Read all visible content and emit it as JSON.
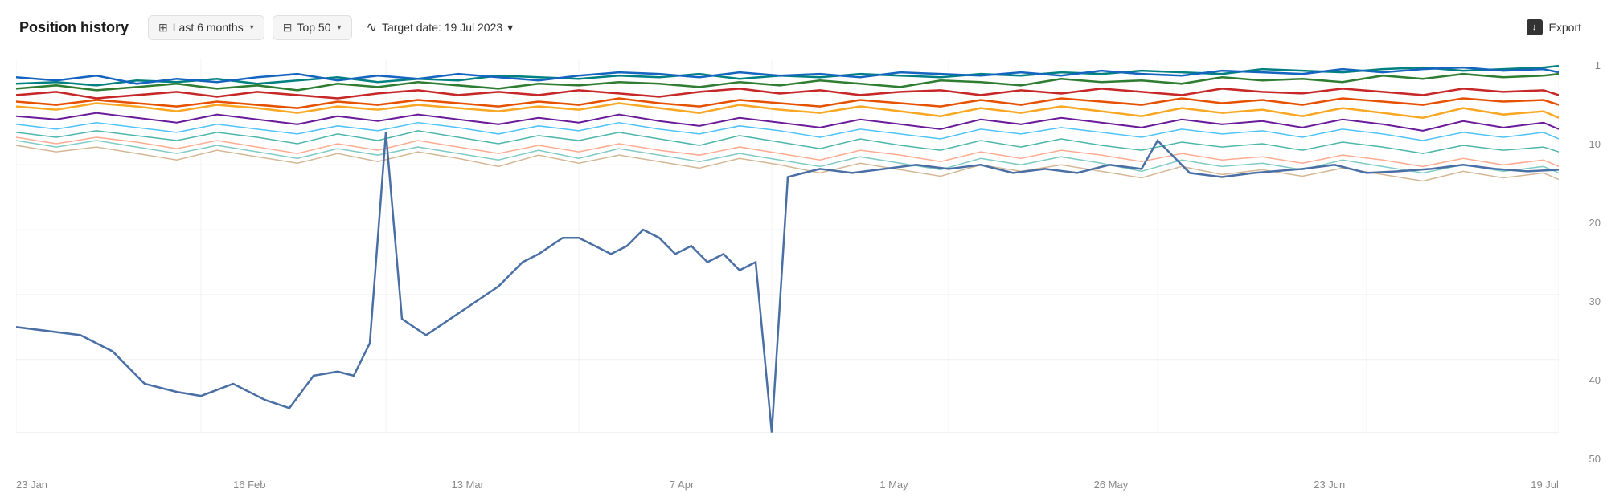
{
  "header": {
    "title": "Position history",
    "filter1": {
      "icon": "📅",
      "label": "Last 6 months",
      "chevron": "▾"
    },
    "filter2": {
      "icon": "📋",
      "label": "Top 50",
      "chevron": "▾"
    },
    "target": {
      "icon": "∿",
      "label": "Target date: 19 Jul 2023",
      "chevron": "▾"
    },
    "export": {
      "label": "Export"
    }
  },
  "chart": {
    "xLabels": [
      "23 Jan",
      "16 Feb",
      "13 Mar",
      "7 Apr",
      "1 May",
      "26 May",
      "23 Jun",
      "19 Jul"
    ],
    "yLabels": [
      "1",
      "10",
      "20",
      "30",
      "40",
      "50"
    ],
    "colors": {
      "accent": "#4a6fa5",
      "grid": "#f0f0f0"
    }
  }
}
